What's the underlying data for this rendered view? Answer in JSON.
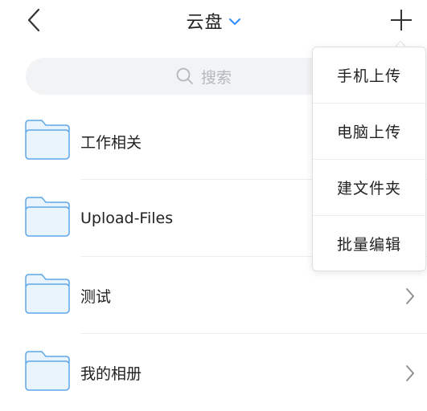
{
  "header": {
    "title": "云盘"
  },
  "search": {
    "placeholder": "搜索"
  },
  "folders": [
    {
      "name": "工作相关"
    },
    {
      "name": "Upload-Files"
    },
    {
      "name": "测试"
    },
    {
      "name": "我的相册"
    }
  ],
  "menu": {
    "items": [
      {
        "label": "手机上传"
      },
      {
        "label": "电脑上传"
      },
      {
        "label": "建文件夹"
      },
      {
        "label": "批量编辑"
      }
    ]
  },
  "colors": {
    "accent": "#2f8cff",
    "folder_fill": "#eaf4fd",
    "folder_stroke": "#5ea7e8",
    "search_bg": "#f2f3f5",
    "placeholder_text": "#b4b7bd",
    "chevron": "#8a8a8a"
  },
  "icons": {
    "back": "chevron-left-icon",
    "title_dropdown": "chevron-down-icon",
    "add": "plus-icon",
    "search": "search-icon",
    "folder": "folder-icon",
    "row_arrow": "chevron-right-icon"
  }
}
